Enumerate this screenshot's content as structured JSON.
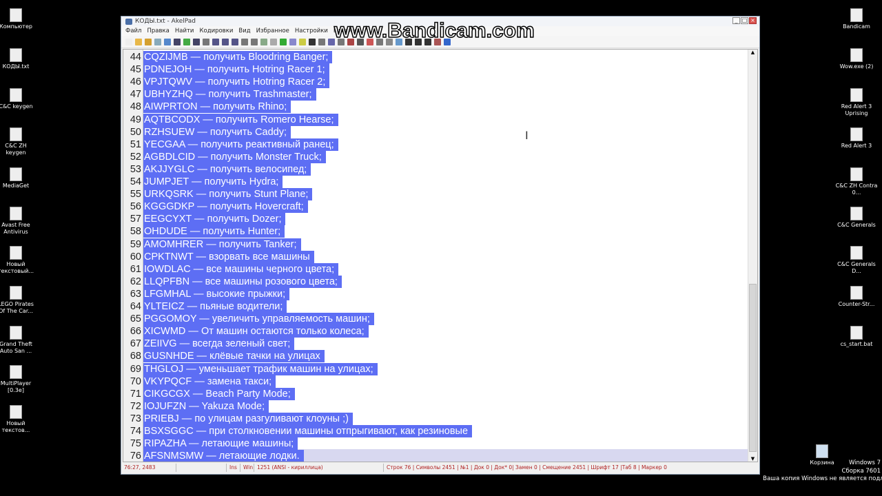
{
  "desktop_left": [
    "Компьютер",
    "КОДЫ.txt",
    "C&C keygen",
    "C&C ZH keygen",
    "MediaGet",
    "Avast Free Antivirus",
    "Новый текстовый...",
    "LEGO Pirates Of The Car...",
    "Grand Theft Auto San ...",
    "MultiPlayer [0.3e]",
    "Новый текстов..."
  ],
  "desktop_right": [
    "Bandicam",
    "Wow.exe (2)",
    "Red Alert 3 Uprising",
    "Red Alert 3",
    "C&C ZH Contra 0...",
    "C&C Generals",
    "C&C Generals D...",
    "Counter-Str...",
    "cs_start.bat"
  ],
  "recycle_bin": "Корзина",
  "system": {
    "os": "Windows 7",
    "build": "Сборка 7601",
    "notice": "Ваша копия Windows не является подлинной"
  },
  "watermark": "www.Bandicam.com",
  "window": {
    "title": "КОДЫ.txt - AkelPad",
    "menu": [
      "Файл",
      "Правка",
      "Найти",
      "Кодировки",
      "Вид",
      "Избранное",
      "Настройки",
      "Плагины"
    ]
  },
  "editor": {
    "lines": [
      {
        "n": "44",
        "t": "CQZIJMB — получить Bloodring Banger;"
      },
      {
        "n": "45",
        "t": "PDNEJOH — получить Hotring Racer 1;"
      },
      {
        "n": "46",
        "t": "VPJTQWV — получить Hotring Racer 2;"
      },
      {
        "n": "47",
        "t": "UBHYZHQ — получить Trashmaster;"
      },
      {
        "n": "48",
        "t": "AIWPRTON — получить Rhino;"
      },
      {
        "n": "49",
        "t": "AQTBCODX — получить Romero Hearse;"
      },
      {
        "n": "50",
        "t": "RZHSUEW — получить Caddy;"
      },
      {
        "n": "51",
        "t": "YECGAA — получить реактивный ранец;"
      },
      {
        "n": "52",
        "t": "AGBDLCID — получить Monster Truck;"
      },
      {
        "n": "53",
        "t": "AKJJYGLC — получить велосипед;"
      },
      {
        "n": "54",
        "t": "JUMPJET — получить Hydra;"
      },
      {
        "n": "55",
        "t": "URKQSRK — получить Stunt Plane;"
      },
      {
        "n": "56",
        "t": "KGGGDKP — получить Hovercraft;"
      },
      {
        "n": "57",
        "t": "EEGCYXT — получить Dozer;"
      },
      {
        "n": "58",
        "t": "OHDUDE — получить Hunter;"
      },
      {
        "n": "59",
        "t": "AMOMHRER — получить Tanker;"
      },
      {
        "n": "60",
        "t": "CPKTNWT — взорвать все машины"
      },
      {
        "n": "61",
        "t": "IOWDLAC — все машины черного цвета;"
      },
      {
        "n": "62",
        "t": "LLQPFBN — все машины розового цвета;"
      },
      {
        "n": "63",
        "t": "LFGMHAL — высокие прыжки;"
      },
      {
        "n": "64",
        "t": "YLTEICZ — пьяные водители;"
      },
      {
        "n": "65",
        "t": "PGGOMOY — увеличить управляемость машин;"
      },
      {
        "n": "66",
        "t": "XICWMD — От машин остаются только колеса;"
      },
      {
        "n": "67",
        "t": "ZEIIVG — всегда зеленый свет;"
      },
      {
        "n": "68",
        "t": "GUSNHDE — клёвые тачки на улицах"
      },
      {
        "n": "69",
        "t": "THGLOJ — уменьшает трафик машин на улицах;"
      },
      {
        "n": "70",
        "t": "VKYPQCF — замена такси;"
      },
      {
        "n": "71",
        "t": "CIKGCGX — Beach Party Mode;"
      },
      {
        "n": "72",
        "t": "IOJUFZN — Yakuza Mode;"
      },
      {
        "n": "73",
        "t": "PRIEBJ — по улицам разгуливают клоуны ;)"
      },
      {
        "n": "74",
        "t": "BSXSGGC — при столкновении машины отпрыгивают, как резиновые"
      },
      {
        "n": "75",
        "t": "RIPAZHA — летающие машины;"
      },
      {
        "n": "76",
        "t": "AFSNMSMW — летающие лодки."
      }
    ],
    "selection_color": "#5d6ef4"
  },
  "status": {
    "pos": "76:27, 2483",
    "blank": "",
    "ins": "Ins",
    "win": "Win",
    "encoding": "1251  (ANSI - кириллица)",
    "info": "Строк 76 | Символы 2451 | №1 | Док 0 | Док* 0| Замен 0 | Смещение 2451 | Шрифт 17 |Таб 8 | Маркер 0"
  }
}
